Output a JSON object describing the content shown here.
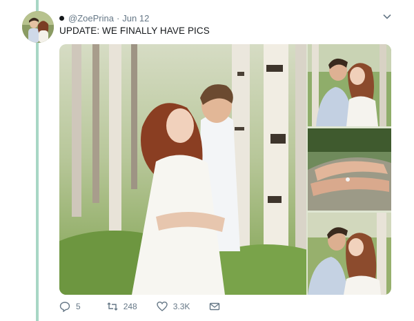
{
  "tweet": {
    "handle": "@ZoePrina",
    "separator": "·",
    "date": "Jun 12",
    "text": "UPDATE: WE FINALLY HAVE PICS"
  },
  "actions": {
    "replies": "5",
    "retweets": "248",
    "likes": "3.3K"
  },
  "icons": {
    "reply": "reply-icon",
    "retweet": "retweet-icon",
    "like": "heart-icon",
    "dm": "envelope-icon",
    "menu": "chevron-down-icon"
  },
  "colors": {
    "thread_line": "#a8d7c5",
    "meta_text": "#657786",
    "text": "#14171a"
  }
}
